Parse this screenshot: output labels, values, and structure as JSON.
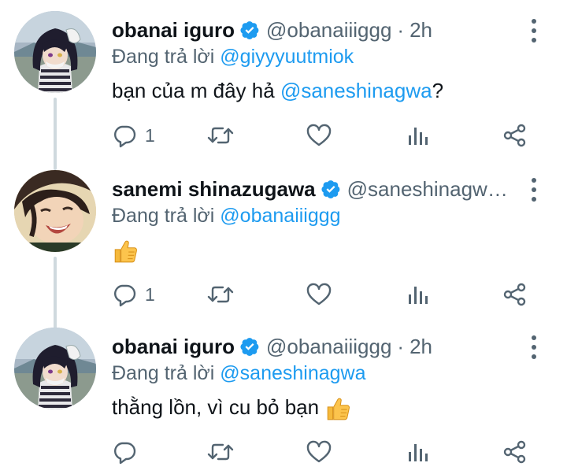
{
  "colors": {
    "accent": "#1d9bf0",
    "text": "#0f1419",
    "muted": "#536471",
    "thread_line": "#cfd9de"
  },
  "tweets": [
    {
      "name": "obanai iguro",
      "handle": "@obanaiiiggg",
      "separator": "·",
      "time": "2h",
      "replying_prefix": "Đang trả lời",
      "replying_to": "@giyyyuutmiok",
      "body_before": "bạn của m đây hả",
      "body_mention": "@saneshinagwa",
      "body_after": "?",
      "reply_count": "1",
      "avatar": "obanai-avatar"
    },
    {
      "name": "sanemi shinazugawa",
      "handle": "@saneshinagw…",
      "separator": "",
      "time": "",
      "replying_prefix": "Đang trả lời",
      "replying_to": "@obanaiiiggg",
      "body_before": "",
      "body_mention": "",
      "body_after": "",
      "body_emoji": "thumbs-up",
      "reply_count": "1",
      "avatar": "sanemi-avatar"
    },
    {
      "name": "obanai iguro",
      "handle": "@obanaiiiggg",
      "separator": "·",
      "time": "2h",
      "replying_prefix": "Đang trả lời",
      "replying_to": "@saneshinagwa",
      "body_before": "thằng lồn, vì cu bỏ bạn",
      "body_mention": "",
      "body_after": "",
      "body_emoji": "thumbs-up",
      "reply_count": "",
      "avatar": "obanai-avatar"
    }
  ],
  "action_icons": [
    "reply-icon",
    "retweet-icon",
    "like-icon",
    "analytics-icon",
    "share-icon"
  ]
}
